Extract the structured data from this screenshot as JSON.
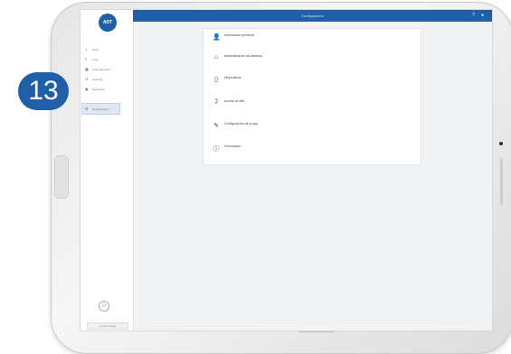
{
  "app": {
    "logo_text": "ADT",
    "subbrand": "",
    "accent_color": "#1f5fa8"
  },
  "topbar": {
    "title": "Configuración",
    "icons": [
      "help-icon",
      "user-icon"
    ]
  },
  "sidebar": {
    "items": [
      {
        "icon": "home-icon",
        "label": "Inicio"
      },
      {
        "icon": "list-icon",
        "label": "Lista"
      },
      {
        "icon": "automation-icon",
        "label": "Automatización"
      },
      {
        "icon": "history-icon",
        "label": "Historial"
      },
      {
        "icon": "security-icon",
        "label": "Seguridad"
      },
      {
        "icon": "blank-icon",
        "label": ""
      },
      {
        "icon": "gear-icon",
        "label": "Configuración"
      }
    ],
    "footer_button": "Cerrar sesión"
  },
  "step": {
    "number": "13"
  },
  "settings": [
    {
      "icon": "person-icon",
      "title": "Información personal",
      "desc": ""
    },
    {
      "icon": "home-icon",
      "title": "Administración del sistema",
      "desc": ""
    },
    {
      "icon": "device-icon",
      "title": "Dispositivos",
      "desc": ""
    },
    {
      "icon": "ear-icon",
      "title": "Acceso al sitio",
      "desc": ""
    },
    {
      "icon": "wrench-icon",
      "title": "Configuración de la app",
      "desc": ""
    },
    {
      "icon": "info-icon",
      "title": "Información",
      "desc": ""
    }
  ]
}
